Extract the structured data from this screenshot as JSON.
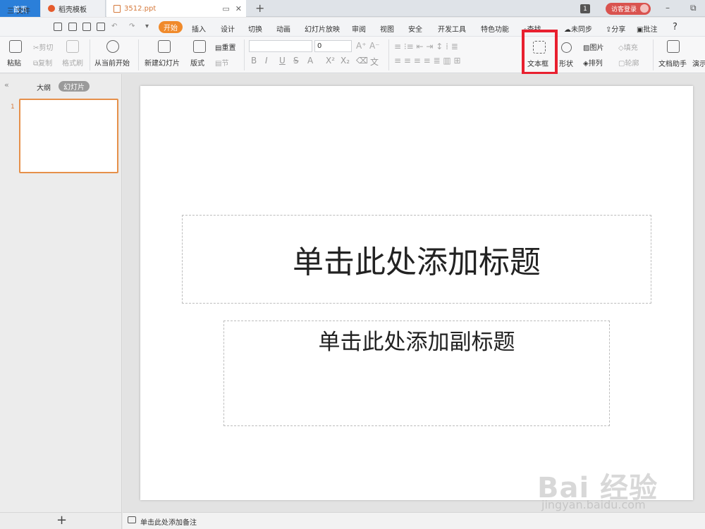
{
  "tabs": {
    "home": "首页",
    "template": "稻壳模板",
    "doc": "3512.ppt",
    "add": "+"
  },
  "titlebar": {
    "badge": "1",
    "visitor_login": "访客登录",
    "restore": "⧉",
    "minimize": "–"
  },
  "menu": {
    "file": "三 文件",
    "active": "开始",
    "items": [
      "插入",
      "设计",
      "切换",
      "动画",
      "幻灯片放映",
      "审阅",
      "视图",
      "安全",
      "开发工具",
      "特色功能"
    ],
    "search": "查找",
    "sync": "未同步",
    "share": "分享",
    "comment": "批注",
    "help": "?"
  },
  "ribbon": {
    "paste": "粘贴",
    "cut": "剪切",
    "copy": "复制",
    "format_painter": "格式刷",
    "from_current": "从当前开始",
    "new_slide": "新建幻灯片",
    "layout": "版式",
    "reset": "重置",
    "section": "节",
    "font_size": "0",
    "text_box": "文本框",
    "shape": "形状",
    "picture": "图片",
    "fill": "填充",
    "arrange": "排列",
    "outline": "轮廓",
    "doc_assistant": "文档助手",
    "present": "演示"
  },
  "leftpane": {
    "outline": "大纲",
    "slides": "幻灯片",
    "slide_number": "1",
    "collapse": "«",
    "add": "+"
  },
  "slide": {
    "title_placeholder": "单击此处添加标题",
    "subtitle_placeholder": "单击此处添加副标题"
  },
  "notes": {
    "placeholder": "单击此处添加备注"
  },
  "watermark": {
    "brand": "Bai 经验",
    "url": "jingyan.baidu.com"
  }
}
